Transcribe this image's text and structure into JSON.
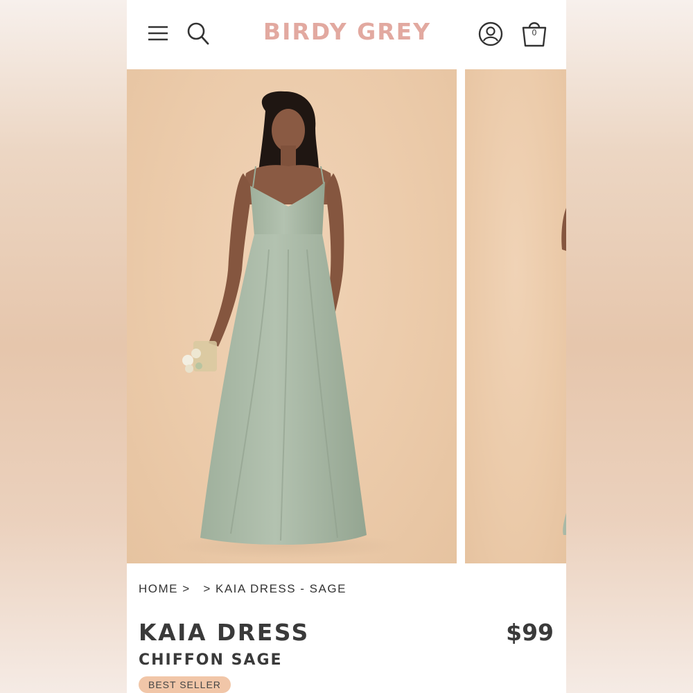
{
  "header": {
    "brand": "BIRDY GREY",
    "menu_icon": "hamburger-menu-icon",
    "search_icon": "search-icon",
    "account_icon": "account-icon",
    "bag_icon": "shopping-bag-icon",
    "bag_count": "0",
    "brand_color": "#e2a9a0"
  },
  "gallery": {
    "images": [
      "model-in-sage-dress",
      "next-product-image"
    ],
    "background_color": "#ebcaa9",
    "dress_color": "#a9b9a6"
  },
  "breadcrumb": {
    "home": "HOME",
    "sep1": " > ",
    "sep2": "  > ",
    "current": "KAIA DRESS - SAGE"
  },
  "product": {
    "title": "KAIA DRESS",
    "subtitle": "CHIFFON SAGE",
    "price": "$99",
    "badge": "BEST SELLER",
    "badge_color": "#f1c6a8"
  }
}
